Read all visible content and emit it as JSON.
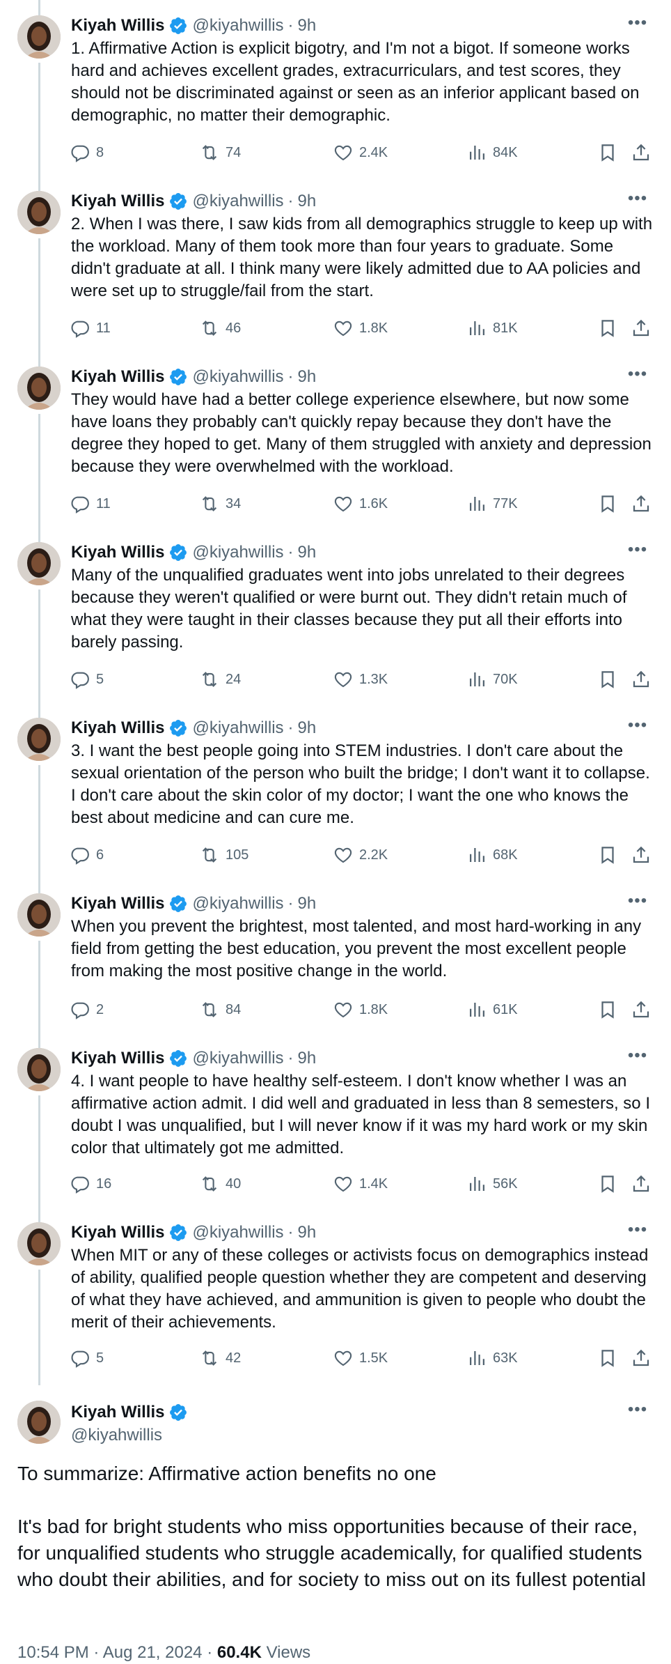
{
  "author": {
    "name": "Kiyah Willis",
    "handle": "@kiyahwillis",
    "time": "9h"
  },
  "colors": {
    "verified": "#1d9bf0",
    "muted": "#536471",
    "text": "#0f1419",
    "thread_line": "#cfd9de"
  },
  "tweets": [
    {
      "text": "1. Affirmative Action is explicit bigotry, and I'm not a bigot. If someone works hard and achieves excellent grades, extracurriculars, and test scores, they should not be discriminated against or seen as an inferior applicant based on demographic, no matter their demographic.",
      "replies": "8",
      "reposts": "74",
      "likes": "2.4K",
      "views": "84K"
    },
    {
      "text": "2. When I was there, I saw kids from all demographics struggle to keep up with the workload. Many of them took more than four years to graduate. Some didn't graduate at all. I think many were likely admitted due to AA policies and were set up to struggle/fail from the start.",
      "replies": "11",
      "reposts": "46",
      "likes": "1.8K",
      "views": "81K"
    },
    {
      "text": "They would have had a better college experience elsewhere, but now some have loans they probably can't quickly repay because they don't have the degree they hoped to get. Many of them struggled with anxiety and depression because they were overwhelmed with the workload.",
      "replies": "11",
      "reposts": "34",
      "likes": "1.6K",
      "views": "77K"
    },
    {
      "text": "Many of the unqualified graduates went into jobs unrelated to their degrees because they weren't qualified or were burnt out. They didn't retain much of what they were taught in their classes because they put all their efforts into barely passing.",
      "replies": "5",
      "reposts": "24",
      "likes": "1.3K",
      "views": "70K"
    },
    {
      "text": "3. I want the best people going into STEM industries. I don't care about the sexual orientation of the person who built the bridge; I don't want it to collapse. I don't care about the skin color of my doctor; I want the one who knows the best about medicine and can cure me.",
      "replies": "6",
      "reposts": "105",
      "likes": "2.2K",
      "views": "68K"
    },
    {
      "text": "When you prevent the brightest, most talented, and most hard-working in any field from getting the best education, you prevent the most excellent people from making the most positive change in the world.",
      "replies": "2",
      "reposts": "84",
      "likes": "1.8K",
      "views": "61K"
    },
    {
      "text": "4. I want people to have healthy self-esteem. I don't know whether I was an affirmative action admit. I did well and graduated in less than 8 semesters, so I doubt I was unqualified, but I will never know if it was my hard work or my skin color that ultimately got me admitted.",
      "replies": "16",
      "reposts": "40",
      "likes": "1.4K",
      "views": "56K"
    },
    {
      "text": "When MIT or any of these colleges or activists focus on demographics instead of ability, qualified people question whether they are competent and deserving of what they have achieved, and ammunition is given to people who doubt the merit of their achievements.",
      "replies": "5",
      "reposts": "42",
      "likes": "1.5K",
      "views": "63K"
    }
  ],
  "final": {
    "text": "To summarize: Affirmative action benefits no one\n\nIt's bad for bright students who miss opportunities because of their race, for unqualified students who struggle academically, for qualified students who doubt their abilities, and for society to miss out on its fullest potential",
    "timestamp": "10:54 PM · Aug 21, 2024 · ",
    "views_count": "60.4K",
    "views_label": " Views"
  }
}
